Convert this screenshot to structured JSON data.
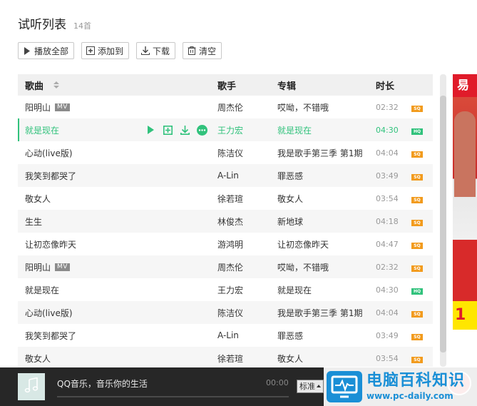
{
  "header": {
    "title": "试听列表",
    "count": "14首"
  },
  "toolbar": {
    "play_all": "播放全部",
    "add_to": "添加到",
    "download": "下载",
    "clear": "清空"
  },
  "columns": {
    "song": "歌曲",
    "singer": "歌手",
    "album": "专辑",
    "duration": "时长"
  },
  "songs": [
    {
      "title": "阳明山",
      "mv": "MV",
      "singer": "周杰伦",
      "album": "哎呦，不错哦",
      "duration": "02:32",
      "quality": "SQ"
    },
    {
      "title": "就是现在",
      "mv": "",
      "singer": "王力宏",
      "album": "就是现在",
      "duration": "04:30",
      "quality": "HQ"
    },
    {
      "title": "心动(live版)",
      "mv": "",
      "singer": "陈洁仪",
      "album": "我是歌手第三季 第1期",
      "duration": "04:04",
      "quality": "SQ"
    },
    {
      "title": "我笑到都哭了",
      "mv": "",
      "singer": "A-Lin",
      "album": "罪恶感",
      "duration": "03:49",
      "quality": "SQ"
    },
    {
      "title": "敬女人",
      "mv": "",
      "singer": "徐若瑄",
      "album": "敬女人",
      "duration": "03:54",
      "quality": "SQ"
    },
    {
      "title": "生生",
      "mv": "",
      "singer": "林俊杰",
      "album": "新地球",
      "duration": "04:18",
      "quality": "SQ"
    },
    {
      "title": "让初恋像昨天",
      "mv": "",
      "singer": "游鸿明",
      "album": "让初恋像昨天",
      "duration": "04:47",
      "quality": "SQ"
    },
    {
      "title": "阳明山",
      "mv": "MV",
      "singer": "周杰伦",
      "album": "哎呦，不错哦",
      "duration": "02:32",
      "quality": "SQ"
    },
    {
      "title": "就是现在",
      "mv": "",
      "singer": "王力宏",
      "album": "就是现在",
      "duration": "04:30",
      "quality": "HQ"
    },
    {
      "title": "心动(live版)",
      "mv": "",
      "singer": "陈洁仪",
      "album": "我是歌手第三季 第1期",
      "duration": "04:04",
      "quality": "SQ"
    },
    {
      "title": "我笑到都哭了",
      "mv": "",
      "singer": "A-Lin",
      "album": "罪恶感",
      "duration": "03:49",
      "quality": "SQ"
    },
    {
      "title": "敬女人",
      "mv": "",
      "singer": "徐若瑄",
      "album": "敬女人",
      "duration": "03:54",
      "quality": "SQ"
    }
  ],
  "active_row": 1,
  "ad": {
    "top_text": "易",
    "bottom_text": "1"
  },
  "player": {
    "title": "QQ音乐，音乐你的生活",
    "time": "00:00",
    "quality": "标准",
    "progress": 0
  },
  "watermark": {
    "name": "电脑百科知识",
    "url": "www.pc-daily.com"
  },
  "colors": {
    "accent": "#31c27c",
    "sq": "#f29b1d",
    "player_bg": "#272727"
  }
}
